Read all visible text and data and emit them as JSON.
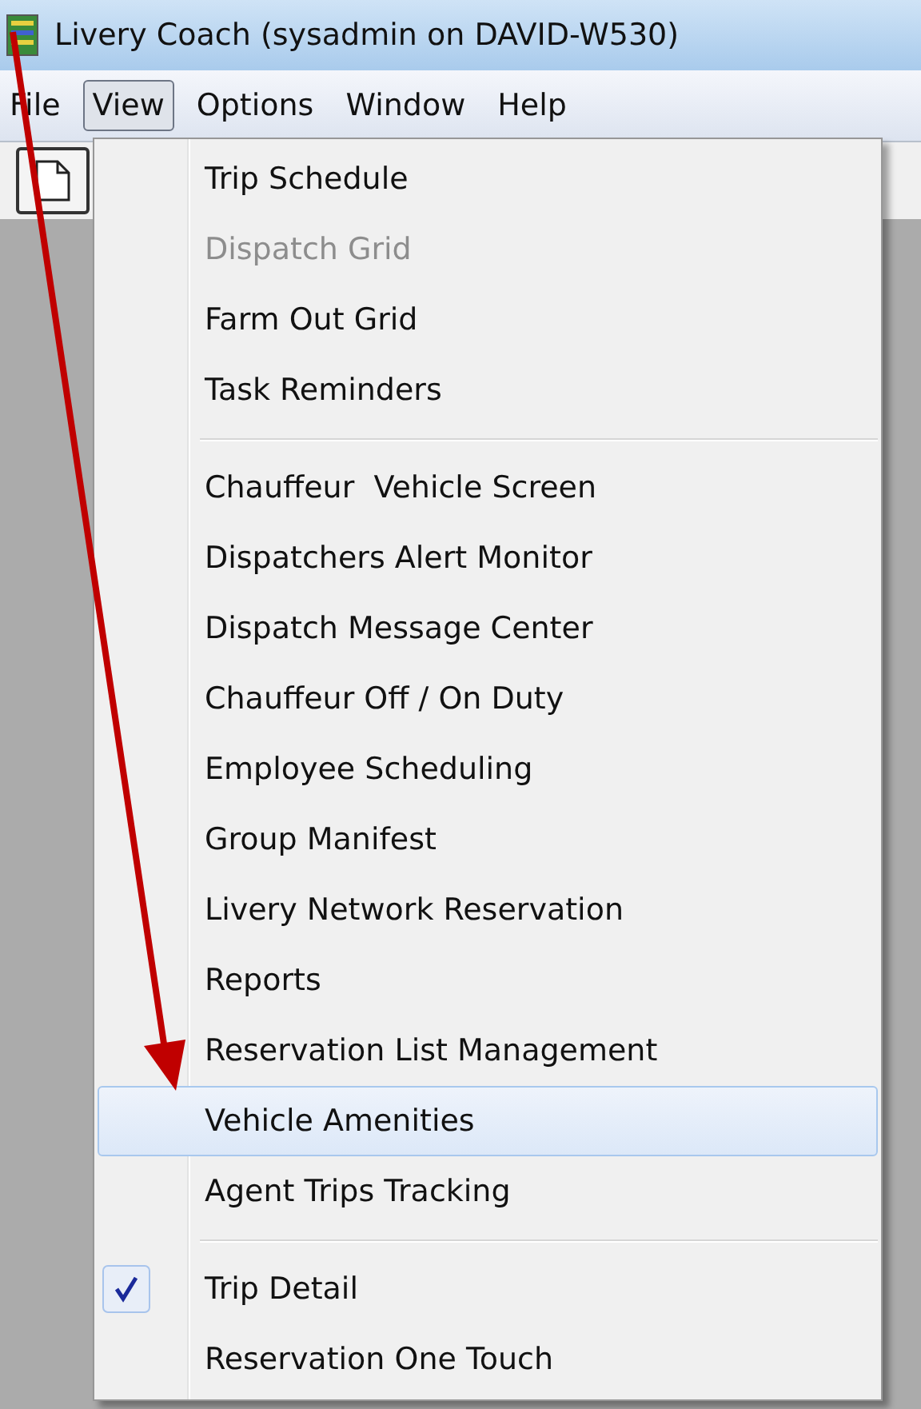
{
  "window": {
    "title": "Livery Coach (sysadmin on DAVID-W530)"
  },
  "menu_bar": [
    {
      "label": "File",
      "selected": false
    },
    {
      "label": "View",
      "selected": true
    },
    {
      "label": "Options",
      "selected": false
    },
    {
      "label": "Window",
      "selected": false
    },
    {
      "label": "Help",
      "selected": false
    }
  ],
  "view_menu": [
    {
      "kind": "item",
      "label": "Trip Schedule",
      "disabled": false,
      "selected": false,
      "checked": false
    },
    {
      "kind": "item",
      "label": "Dispatch Grid",
      "disabled": true,
      "selected": false,
      "checked": false
    },
    {
      "kind": "item",
      "label": "Farm Out Grid",
      "disabled": false,
      "selected": false,
      "checked": false
    },
    {
      "kind": "item",
      "label": "Task Reminders",
      "disabled": false,
      "selected": false,
      "checked": false
    },
    {
      "kind": "separator"
    },
    {
      "kind": "item",
      "label": "Chauffeur  Vehicle Screen",
      "disabled": false,
      "selected": false,
      "checked": false
    },
    {
      "kind": "item",
      "label": "Dispatchers Alert Monitor",
      "disabled": false,
      "selected": false,
      "checked": false
    },
    {
      "kind": "item",
      "label": "Dispatch Message Center",
      "disabled": false,
      "selected": false,
      "checked": false
    },
    {
      "kind": "item",
      "label": "Chauffeur Off / On Duty",
      "disabled": false,
      "selected": false,
      "checked": false
    },
    {
      "kind": "item",
      "label": "Employee Scheduling",
      "disabled": false,
      "selected": false,
      "checked": false
    },
    {
      "kind": "item",
      "label": "Group Manifest",
      "disabled": false,
      "selected": false,
      "checked": false
    },
    {
      "kind": "item",
      "label": "Livery Network Reservation",
      "disabled": false,
      "selected": false,
      "checked": false
    },
    {
      "kind": "item",
      "label": "Reports",
      "disabled": false,
      "selected": false,
      "checked": false
    },
    {
      "kind": "item",
      "label": "Reservation List Management",
      "disabled": false,
      "selected": false,
      "checked": false
    },
    {
      "kind": "item",
      "label": "Vehicle Amenities",
      "disabled": false,
      "selected": true,
      "checked": false
    },
    {
      "kind": "item",
      "label": "Agent Trips Tracking",
      "disabled": false,
      "selected": false,
      "checked": false
    },
    {
      "kind": "separator"
    },
    {
      "kind": "item",
      "label": "Trip Detail",
      "disabled": false,
      "selected": false,
      "checked": true
    },
    {
      "kind": "item",
      "label": "Reservation One Touch",
      "disabled": false,
      "selected": false,
      "checked": false
    }
  ]
}
